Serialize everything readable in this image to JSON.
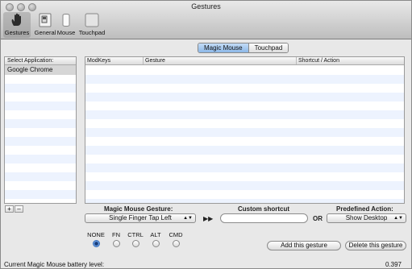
{
  "window": {
    "title": "Gestures"
  },
  "toolbar": {
    "items": [
      {
        "label": "Gestures",
        "icon": "hand-icon"
      },
      {
        "label": "General",
        "icon": "switch-icon"
      },
      {
        "label": "Mouse",
        "icon": "mouse-icon"
      },
      {
        "label": "Touchpad",
        "icon": "touchpad-icon"
      }
    ]
  },
  "sidebar": {
    "header": "Select Application:",
    "items": [
      "Google Chrome"
    ],
    "add_label": "+",
    "remove_label": "–"
  },
  "device_tabs": {
    "items": [
      "Magic Mouse",
      "Touchpad"
    ],
    "active": "Magic Mouse"
  },
  "table": {
    "columns": [
      "ModKeys",
      "Gesture",
      "Shortcut / Action"
    ],
    "rows": []
  },
  "controls": {
    "gesture_label": "Magic Mouse Gesture:",
    "gesture_value": "Single Finger Tap Left",
    "arrow_glyph": "▶▶",
    "shortcut_label": "Custom shortcut",
    "shortcut_value": "",
    "or_label": "OR",
    "action_label": "Predefined Action:",
    "action_value": "Show Desktop",
    "modifiers": [
      {
        "label": "NONE",
        "selected": true
      },
      {
        "label": "FN",
        "selected": false
      },
      {
        "label": "CTRL",
        "selected": false
      },
      {
        "label": "ALT",
        "selected": false
      },
      {
        "label": "CMD",
        "selected": false
      }
    ],
    "add_button": "Add this gesture",
    "delete_button": "Delete this gesture"
  },
  "footer": {
    "battery_label": "Current Magic Mouse battery level:",
    "battery_value": "0.397"
  }
}
